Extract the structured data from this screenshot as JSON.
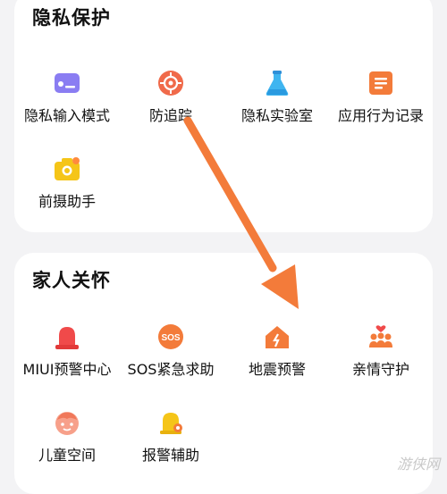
{
  "privacy": {
    "title": "隐私保护",
    "items": [
      {
        "label": "隐私输入模式",
        "icon": "keyboard-icon"
      },
      {
        "label": "防追踪",
        "icon": "target-icon"
      },
      {
        "label": "隐私实验室",
        "icon": "flask-icon"
      },
      {
        "label": "应用行为记录",
        "icon": "notes-icon"
      },
      {
        "label": "前摄助手",
        "icon": "camera-icon"
      }
    ]
  },
  "family": {
    "title": "家人关怀",
    "items": [
      {
        "label": "MIUI预警中心",
        "icon": "alarm-icon"
      },
      {
        "label": "SOS紧急求助",
        "icon": "sos-icon"
      },
      {
        "label": "地震预警",
        "icon": "house-quake-icon"
      },
      {
        "label": "亲情守护",
        "icon": "family-icon"
      },
      {
        "label": "儿童空间",
        "icon": "child-face-icon"
      },
      {
        "label": "报警辅助",
        "icon": "police-bell-icon"
      }
    ]
  },
  "watermark": "游侠网",
  "colors": {
    "accent_orange": "#f37b3a",
    "purple": "#7a6ff0",
    "red": "#f04a4a",
    "blue": "#3fb5f0",
    "yellow": "#f5c518"
  }
}
